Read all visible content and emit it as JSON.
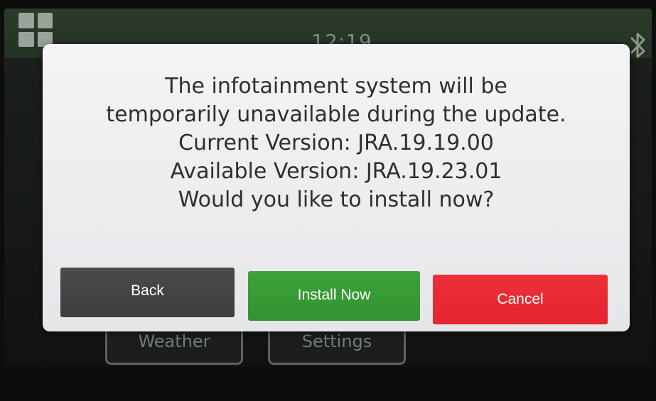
{
  "status_bar": {
    "time": "12:19"
  },
  "home_tiles": {
    "weather_label": "Weather",
    "settings_label": "Settings"
  },
  "dialog": {
    "message_lines": [
      "The infotainment system will be",
      "temporarily unavailable during the update.",
      "Current Version: JRA.19.19.00",
      "Available Version: JRA.19.23.01",
      "Would you like to install now?"
    ],
    "buttons": {
      "back": "Back",
      "install": "Install Now",
      "cancel": "Cancel"
    }
  },
  "colors": {
    "back": "#444444",
    "install": "#38a035",
    "cancel": "#e8282f"
  },
  "icons": {
    "apps": "grid-icon",
    "bluetooth": "bluetooth-icon"
  }
}
